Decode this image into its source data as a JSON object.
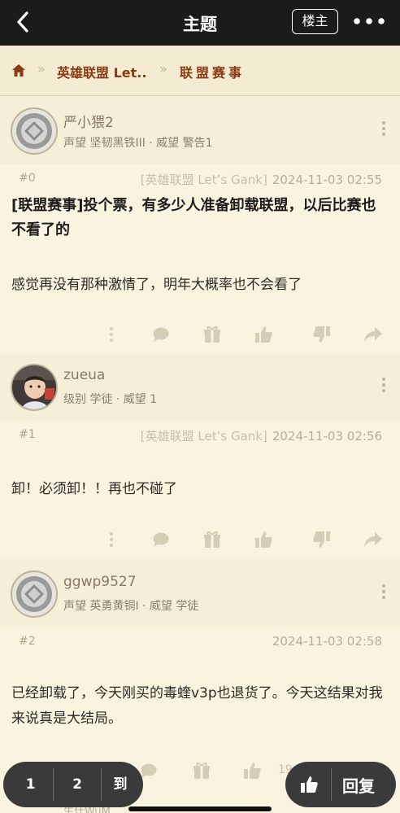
{
  "header": {
    "title": "主题",
    "owner_label": "楼主"
  },
  "breadcrumb": {
    "board": "英雄联盟 Let..",
    "sub": "联盟赛事"
  },
  "posts": [
    {
      "username": "严小猥2",
      "meta": "声望 坚韧黑铁III · 威望 警告1",
      "floor": "#0",
      "source": "[英雄联盟 Let’s Gank]",
      "date": "2024-11-03 02:55",
      "title": "[联盟赛事]投个票，有多少人准备卸载联盟，以后比赛也不看了的",
      "content": "感觉再没有那种激情了，明年大概率也不会看了"
    },
    {
      "username": "zueua",
      "meta": "级别 学徒 · 威望 1",
      "floor": "#1",
      "source": "[英雄联盟 Let’s Gank]",
      "date": "2024-11-03 02:56",
      "content": "卸！必须卸！！再也不碰了"
    },
    {
      "username": "ggwp9527",
      "meta": "声望 英勇黄铜I · 威望 学徒",
      "floor": "#2",
      "date": "2024-11-03 02:58",
      "content": "已经卸载了，今天刚买的毒蝰v3p也退货了。今天这结果对我来说真是大结局。"
    }
  ],
  "pager": {
    "p1": "1",
    "p2": "2",
    "goto": "到"
  },
  "reply": {
    "label": "回复"
  },
  "partial": {
    "count": "19",
    "next_user": "生什WuM"
  },
  "colors": {
    "header_bg": "#1b1b1b",
    "page_bg": "#f6efd8",
    "crumb_text": "#8a3b12",
    "action_icon": "#d6ceb4"
  }
}
